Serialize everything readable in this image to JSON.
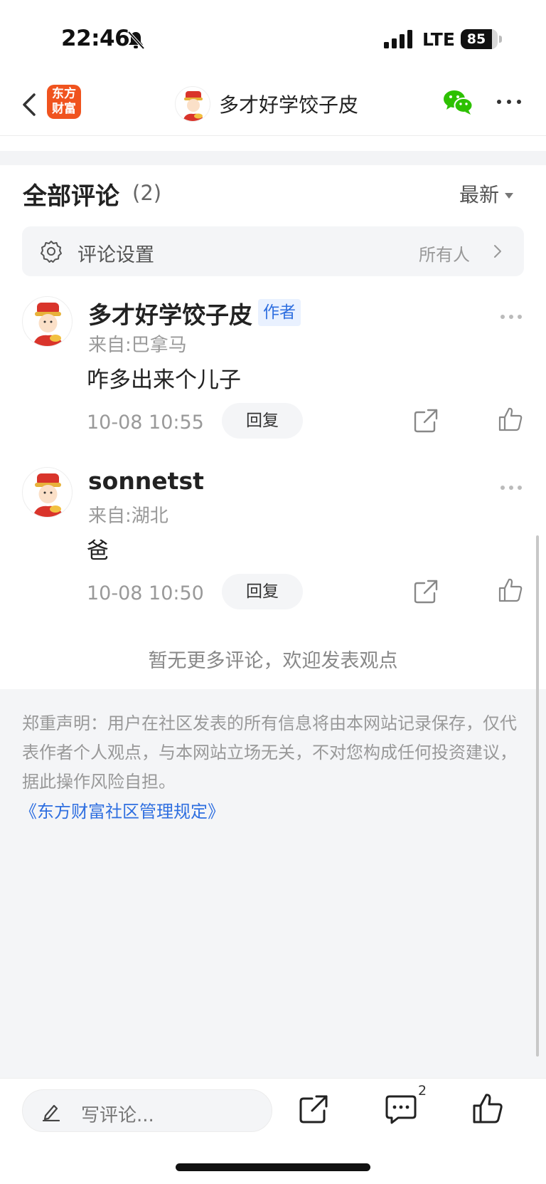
{
  "status_bar": {
    "time": "22:46",
    "network": "LTE",
    "battery_level": "85",
    "battery_fraction": 0.85
  },
  "nav": {
    "app_logo_text": "东方财富",
    "title": "多才好学饺子皮"
  },
  "comments_section": {
    "title": "全部评论",
    "count": "(2)",
    "sort_label": "最新",
    "settings_label": "评论设置",
    "settings_value": "所有人"
  },
  "comments": [
    {
      "name": "多才好学饺子皮",
      "badge": "作者",
      "location": "来自:巴拿马",
      "text": "咋多出来个儿子",
      "time": "10-08 10:55",
      "reply_label": "回复"
    },
    {
      "name": "sonnetst",
      "badge": "",
      "location": "来自:湖北",
      "text": "爸",
      "time": "10-08 10:50",
      "reply_label": "回复"
    }
  ],
  "no_more_text": "暂无更多评论，欢迎发表观点",
  "disclaimer": {
    "text": "郑重声明：用户在社区发表的所有信息将由本网站记录保存，仅代表作者个人观点，与本网站立场无关，不对您构成任何投资建议，据此操作风险自担。",
    "link": "《东方财富社区管理规定》"
  },
  "bottom_bar": {
    "input_placeholder": "写评论...",
    "comment_count": "2"
  },
  "colors": {
    "brand": "#f0531e",
    "link": "#2f6fe0",
    "wechat": "#2dc100",
    "panel_bg": "#f4f5f7"
  },
  "icons": [
    "bell-off-icon",
    "signal-icon",
    "back-icon",
    "app-logo",
    "wechat-icon",
    "more-icon",
    "gear-icon",
    "chevron-right-icon",
    "share-icon",
    "thumbs-up-icon",
    "pen-icon",
    "comment-icon"
  ]
}
